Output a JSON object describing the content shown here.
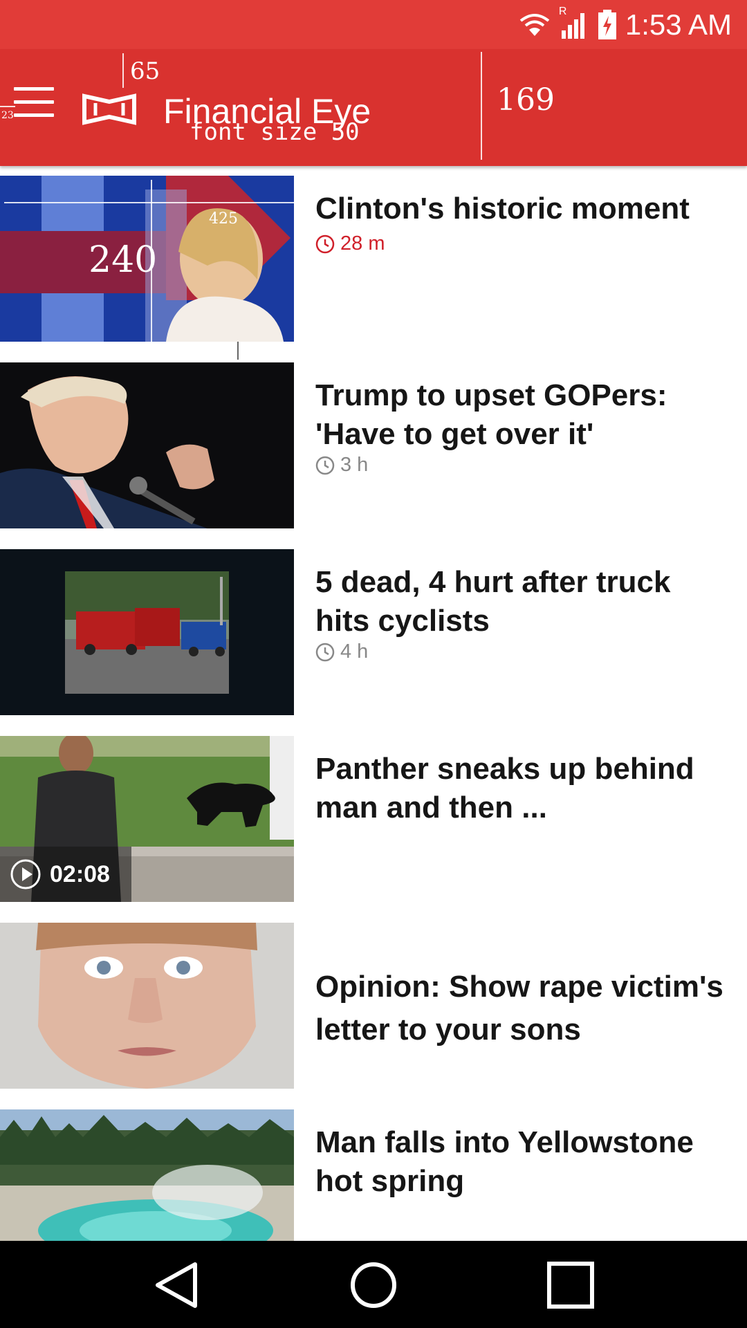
{
  "status_bar": {
    "time": "1:53 AM",
    "icons": [
      "wifi-icon",
      "signal-icon",
      "battery-charging-icon"
    ],
    "roaming_indicator": "R"
  },
  "app_bar": {
    "title": "Financial Eye",
    "menu_icon": "hamburger-menu-icon",
    "logo_icon": "app-logo-icon",
    "annotations": {
      "top_label": "65",
      "left_label": "23",
      "font_note": "font size 50",
      "height_label": "169"
    }
  },
  "colors": {
    "status_bar": "#e13c38",
    "app_bar": "#d9322f",
    "recent_time": "#d0202a",
    "time_grey": "#888888"
  },
  "news": [
    {
      "headline": "Clinton's historic moment",
      "time": "28 m",
      "recent": true,
      "thumb_annotations": {
        "height_label": "240",
        "width_label": "425"
      }
    },
    {
      "headline": "Trump to upset GOPers: 'Have to get over it'",
      "time": "3 h",
      "recent": false
    },
    {
      "headline": "5 dead, 4 hurt after truck hits cyclists",
      "time": "4 h",
      "recent": false
    },
    {
      "headline": "Panther sneaks up behind man and then ...",
      "video_duration": "02:08"
    },
    {
      "headline": "Opinion: Show rape victim's letter to your sons"
    },
    {
      "headline": "Man falls into Yellowstone hot spring"
    }
  ],
  "nav_bar": {
    "buttons": [
      "back-icon",
      "home-icon",
      "recents-icon"
    ]
  }
}
